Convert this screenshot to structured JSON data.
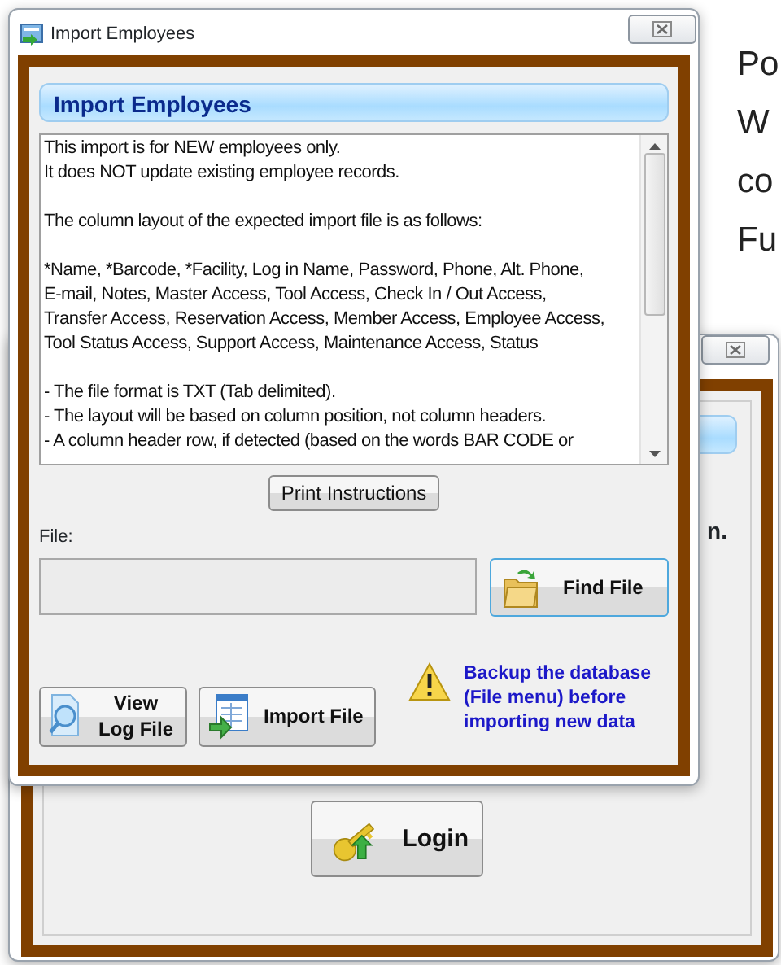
{
  "background_document": {
    "lines": [
      "Po",
      "W",
      "co",
      "Fu"
    ]
  },
  "back_window": {
    "fragment_text": "n.",
    "login_button": "Login"
  },
  "dialog": {
    "title": "Import Employees",
    "header": "Import Employees",
    "instructions": [
      "This import is for NEW employees only.\nIt does NOT update existing employee records.",
      "The column layout of the expected import file is as follows:",
      "*Name, *Barcode, *Facility, Log in Name, Password, Phone, Alt. Phone,\nE-mail, Notes, Master Access, Tool Access, Check In / Out Access,\nTransfer Access, Reservation Access, Member Access, Employee Access,\nTool Status Access, Support Access, Maintenance Access, Status",
      "- The file format is TXT (Tab delimited).\n- The layout will be based on column position, not column headers.\n- A column header row, if detected (based on the words BAR CODE or"
    ],
    "print_button": "Print Instructions",
    "file_label": "File:",
    "find_button": "Find File",
    "view_log_button": [
      "View",
      "Log File"
    ],
    "import_button": "Import File",
    "warning": [
      "Backup the database",
      "(File menu) before",
      "importing new data"
    ]
  }
}
